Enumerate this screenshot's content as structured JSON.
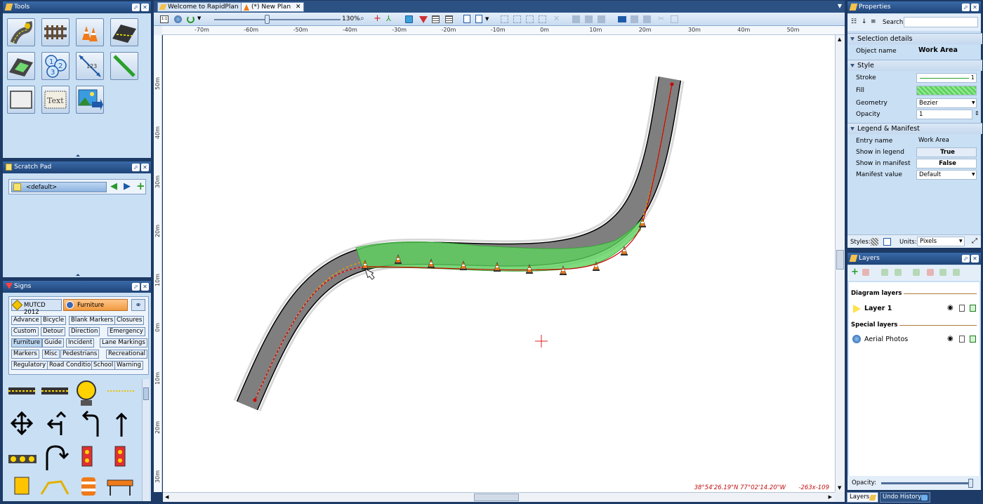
{
  "panels": {
    "tools": {
      "title": "Tools"
    },
    "scratch": {
      "title": "Scratch Pad",
      "default_item": "<default>"
    },
    "signs": {
      "title": "Signs",
      "tabs": [
        "MUTCD 2012",
        "Furniture"
      ],
      "categories": [
        "Advance",
        "Bicycle",
        "Blank Markers",
        "Closures",
        "Custom",
        "Detour",
        "Direction",
        "Emergency",
        "Furniture",
        "Guide",
        "Incident",
        "Lane Markings",
        "Markers",
        "Misc",
        "Pedestrians",
        "Recreational",
        "Regulatory",
        "Road Condition",
        "School",
        "Warning"
      ]
    },
    "tool_text_label": "Text"
  },
  "tabs": [
    "Welcome to RapidPlan",
    "(*) New Plan"
  ],
  "zoom": {
    "label": "130%"
  },
  "ruler": {
    "top": [
      "-70m",
      "-60m",
      "-50m",
      "-40m",
      "-30m",
      "-20m",
      "-10m",
      "0m",
      "10m",
      "20m",
      "30m",
      "40m",
      "50m"
    ],
    "left": [
      "50m",
      "40m",
      "30m",
      "20m",
      "10m",
      "0m",
      "10m",
      "20m",
      "30m"
    ]
  },
  "status": {
    "coords": "38°54'26.19\"N 77°02'14.20\"W",
    "pixel": "-263x-109"
  },
  "properties": {
    "title": "Properties",
    "search_label": "Search:",
    "sections": {
      "selection": "Selection details",
      "style": "Style",
      "legend": "Legend & Manifest"
    },
    "object_name_label": "Object name",
    "object_name_value": "Work Area",
    "stroke_label": "Stroke",
    "stroke_width": "1",
    "fill_label": "Fill",
    "geometry_label": "Geometry",
    "geometry_value": "Bezier",
    "opacity_label": "Opacity",
    "opacity_value": "1",
    "entry_name_label": "Entry name",
    "entry_name_value": "Work Area",
    "show_legend_label": "Show in legend",
    "show_legend_value": "True",
    "show_manifest_label": "Show in manifest",
    "show_manifest_value": "False",
    "manifest_value_label": "Manifest value",
    "manifest_value_value": "Default",
    "styles_label": "Styles:",
    "units_label": "Units:",
    "units_value": "Pixels"
  },
  "layers": {
    "title": "Layers",
    "diagram_header": "Diagram layers",
    "layer1": "Layer 1",
    "special_header": "Special layers",
    "aerial": "Aerial Photos",
    "opacity_label": "Opacity:"
  },
  "bottom_tabs": [
    "Layers",
    "Undo History"
  ],
  "colors": {
    "accent": "#1f4478",
    "road": "#7f7f7f",
    "work_area": "#5ed35e",
    "path": "#cc0000"
  }
}
